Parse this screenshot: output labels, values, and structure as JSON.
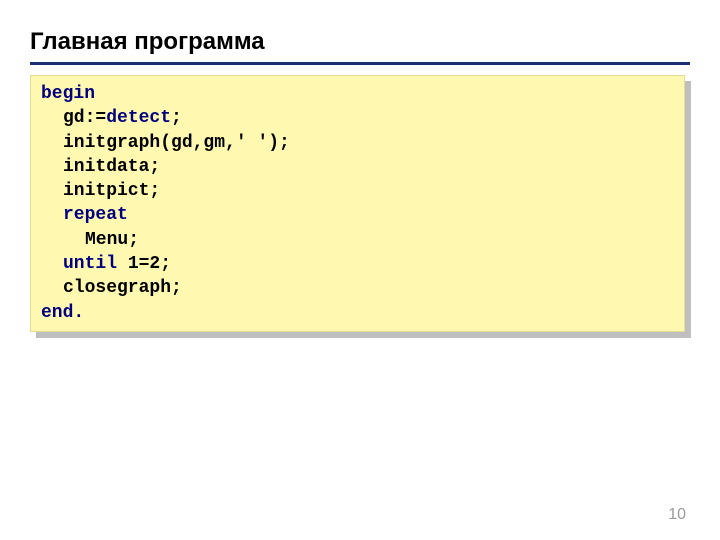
{
  "slide": {
    "title": "Главная программа",
    "page_number": "10"
  },
  "code": {
    "l1": "begin",
    "l2a": "gd:=",
    "l2b": "detect",
    "l2c": ";",
    "l3": "initgraph(gd,gm,' ');",
    "l4": "initdata;",
    "l5": "initpict;",
    "l6": "repeat",
    "l7": "Menu;",
    "l8_until": "until",
    "l8_rest": " 1=2;",
    "l9": "closegraph;",
    "l10": "end."
  }
}
